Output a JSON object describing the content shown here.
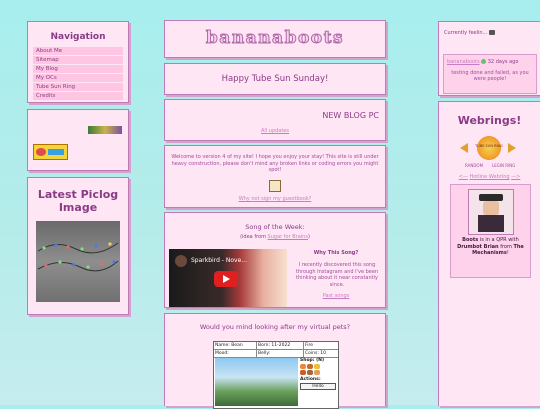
{
  "colors": {
    "bg_top": "#a8eeee",
    "box_bg": "#ffe6f5",
    "border": "#c07ab6",
    "text": "#8a3b86",
    "nav_item_bg": "#ffc6e3"
  },
  "nav": {
    "title": "Navigation",
    "items": [
      {
        "label": "About Me"
      },
      {
        "label": "Sitemap"
      },
      {
        "label": "My Blog"
      },
      {
        "label": "My OCs"
      },
      {
        "label": "Tube Sun Ring"
      },
      {
        "label": "Credits"
      }
    ]
  },
  "piclog": {
    "title": "Latest Piclog Image"
  },
  "header": {
    "logo": "bananaboots"
  },
  "greeting": {
    "text": "Happy Tube Sun Sunday!"
  },
  "blog": {
    "title": "NEW BLOG PC",
    "link": "All updates"
  },
  "welcome": {
    "text": "Welcome to version 4 of my site! I hope you enjoy your stay! This site is still under heavy construction, please don't mind any broken links or coding errors you might spot!",
    "guestbook_link": "Why not sign my guestbook?"
  },
  "song": {
    "title": "Song of the Week:",
    "idea_prefix": "(idea from ",
    "idea_link": "Sugar for Brains",
    "idea_suffix": ")",
    "video_title": "Sparkbird - Nove...",
    "why_title": "Why This Song?",
    "why_text": "I recently discovered this song through Instagram and I've been thinking about it near constantly since.",
    "past_link": "Past songs"
  },
  "pet": {
    "title": "Would you mind looking after my virtual pets?",
    "name_label": "Name: Bean",
    "born_label": "Born: 11-2022",
    "fire_label": "Fire",
    "mood_label": "Mood:",
    "belly_label": "Belly:",
    "coins_label": "Coins: 10",
    "shop_label": "Shop: (N)",
    "actions_label": "Actions:",
    "hello_button": "Hello"
  },
  "status": {
    "currently_label": "Currently feelin...",
    "user": "bananaboots",
    "time": "32 days ago",
    "message": "testing done and failed, as you were people!"
  },
  "webrings": {
    "title": "Webrings!",
    "ring_badge": "TUBE SUN RING",
    "random": "RANDOM",
    "prev_next": "LEGIN RING",
    "hotline_link": "Hotline Webring",
    "hotline_prev": "<—",
    "hotline_next": "—>",
    "oc_name": "Boots",
    "oc_text1": " is in a QPR with ",
    "oc_partner": "Drumbot Brian",
    "oc_text2": " from ",
    "oc_band": "The Mechanisms",
    "oc_end": "!"
  }
}
